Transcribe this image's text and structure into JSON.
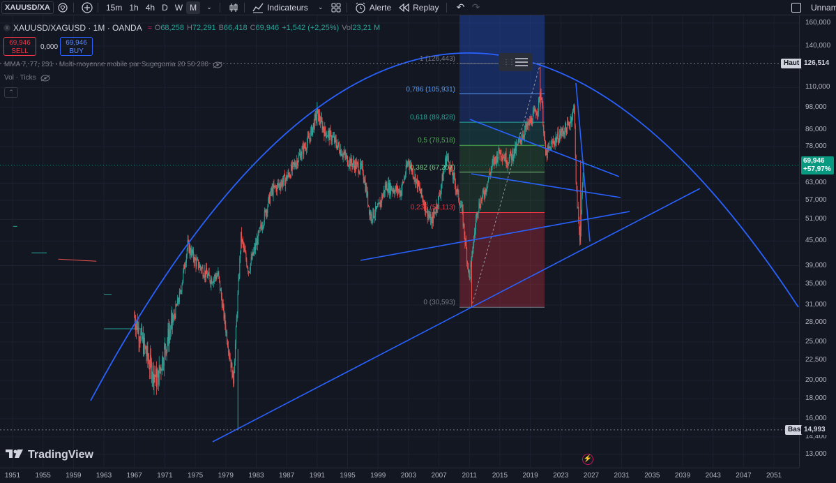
{
  "toolbar": {
    "symbol": "XAUUSD/XAG",
    "intervals": [
      "15m",
      "1h",
      "4h",
      "D",
      "W",
      "M"
    ],
    "active_interval": "M",
    "indicators_label": "Indicateurs",
    "alert_label": "Alerte",
    "replay_label": "Replay",
    "layout_name": "Unnamed"
  },
  "legend": {
    "title": "XAUUSD/XAGUSD · 1M · OANDA",
    "o_label": "O",
    "o_value": "68,258",
    "h_label": "H",
    "h_value": "72,291",
    "b_label": "B",
    "b_value": "66,418",
    "c_label": "C",
    "c_value": "69,946",
    "change": "+1,542 (+2,25%)",
    "vol_label": "Vol",
    "vol_value": "23,21 M"
  },
  "trade": {
    "sell_price": "69,946",
    "sell_label": "SELL",
    "spread": "0,000",
    "buy_price": "69,946",
    "buy_label": "BUY"
  },
  "indicators": [
    "MMA 7, 77, 231 · Multi-moyenne mobile par Sugegorria 20 50 200",
    "Vol · Ticks"
  ],
  "price_axis": {
    "ticks": [
      "160,000",
      "140,000",
      "126,514",
      "110,000",
      "98,000",
      "86,000",
      "78,000",
      "69,946",
      "63,000",
      "57,000",
      "51,000",
      "45,000",
      "39,000",
      "35,000",
      "31,000",
      "28,000",
      "25,000",
      "22,500",
      "20,000",
      "18,000",
      "16,000",
      "14,993",
      "14,400",
      "13,000"
    ],
    "haut_label": "Haut",
    "haut_value": "126,514",
    "bas_label": "Bas",
    "bas_value": "14,993",
    "current_value": "69,946",
    "current_change": "+57,97%"
  },
  "time_axis": {
    "labels": [
      "1951",
      "1955",
      "1959",
      "1963",
      "1967",
      "1971",
      "1975",
      "1979",
      "1983",
      "1987",
      "1991",
      "1995",
      "1999",
      "2003",
      "2007",
      "2011",
      "2015",
      "2019",
      "2023",
      "2027",
      "2031",
      "2035",
      "2039",
      "2043",
      "2047",
      "2051"
    ]
  },
  "fib_levels": [
    {
      "label": "1 (126,443)",
      "value": 126.443,
      "color": "#787b86"
    },
    {
      "label": "0,786 (105,931)",
      "value": 105.931,
      "color": "#5b9cf5"
    },
    {
      "label": "0,618 (89,828)",
      "value": 89.828,
      "color": "#26a69a"
    },
    {
      "label": "0,5 (78,518)",
      "value": 78.518,
      "color": "#4caf50"
    },
    {
      "label": "0,382 (67,207)",
      "value": 67.207,
      "color": "#81c784"
    },
    {
      "label": "0,236 (53,113)",
      "value": 53.113,
      "color": "#f23645"
    },
    {
      "label": "0 (30,593)",
      "value": 30.593,
      "color": "#787b86"
    }
  ],
  "brand": "TradingView",
  "colors": {
    "background": "#131722",
    "up": "#26a69a",
    "down": "#ef5350",
    "trendline": "#2962ff",
    "haut_bg": "#b2b5be",
    "current_bg": "#089981"
  }
}
